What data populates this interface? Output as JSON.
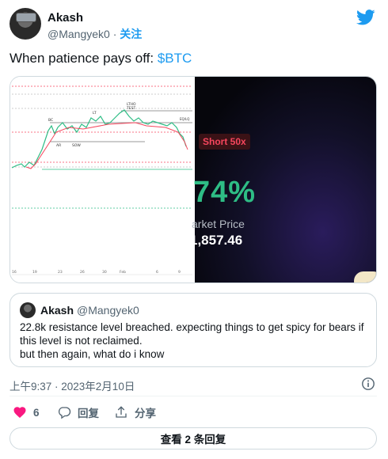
{
  "tweet": {
    "author_name": "Akash",
    "author_handle": "@Mangyek0",
    "separator": "·",
    "follow_label": "关注",
    "text_prefix": "When patience pays off: ",
    "cashtag": "$BTC",
    "timestamp": "上午9:37 · 2023年2月10日"
  },
  "media": {
    "promo": {
      "badge": "Short 50x",
      "percent": "74%",
      "market_label": "arket Price",
      "market_value": "1,857.46"
    },
    "chart_labels": [
      "LT",
      "LTHO",
      "TEST",
      "BC",
      "AR",
      "SOW",
      "EQ/LQ"
    ],
    "x_ticks": [
      "16",
      "19",
      "23",
      "26",
      "30",
      "Feb",
      "6",
      "9"
    ]
  },
  "quote": {
    "author_name": "Akash",
    "author_handle": "@Mangyek0",
    "lines": [
      "22.8k resistance level breached. expecting things to get spicy for bears if",
      "this level is not reclaimed.",
      "but then again, what do i know"
    ]
  },
  "actions": {
    "like_count": "6",
    "reply_label": "回复",
    "share_label": "分享"
  },
  "footer": {
    "view_replies_label": "查看 2 条回复"
  },
  "colors": {
    "accent": "#1d9bf0",
    "like": "#f91880",
    "bull": "#2ebd85",
    "bear": "#f6465d"
  },
  "icons": [
    "twitter-bird-icon",
    "info-icon",
    "heart-icon",
    "reply-icon",
    "share-icon"
  ]
}
